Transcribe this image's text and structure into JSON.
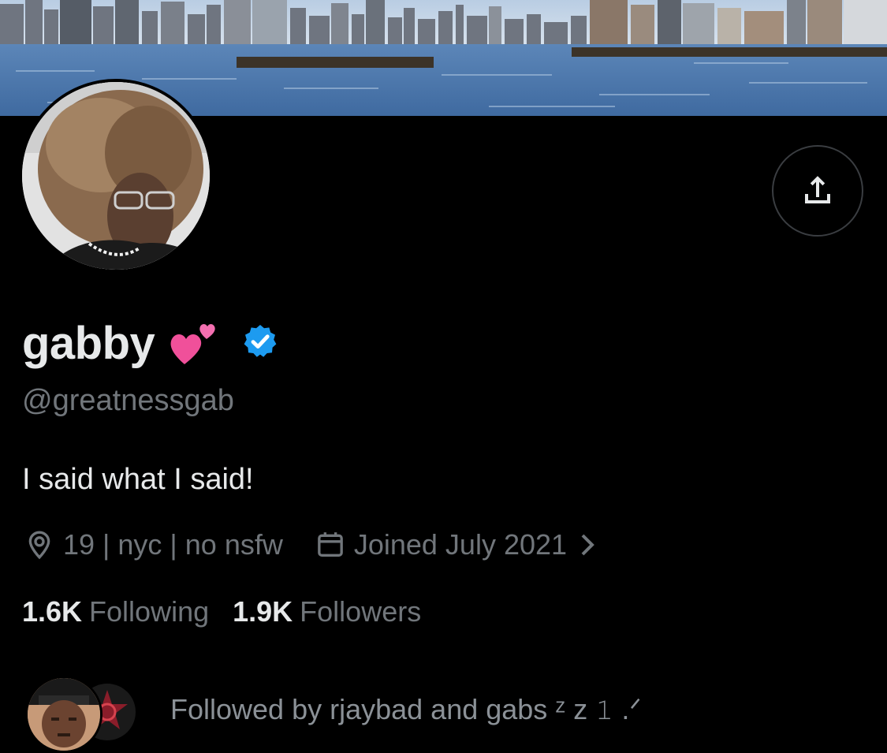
{
  "profile": {
    "display_name": "gabby",
    "name_emoji": "two-hearts-emoji",
    "verified": "verified-badge",
    "handle": "@greatnessgab",
    "bio": "I said what I said!",
    "location": "19 | nyc | no nsfw",
    "joined": "Joined July 2021"
  },
  "stats": {
    "following_count": "1.6K",
    "following_label": "Following",
    "followers_count": "1.9K",
    "followers_label": "Followers"
  },
  "followed_by": {
    "text": "Followed by rjaybad and gabs ᶻ z 𝟷 .ᐟ"
  },
  "icons": {
    "share": "share-icon",
    "location": "location-pin-icon",
    "calendar": "calendar-icon",
    "chevron": "chevron-right-icon"
  },
  "colors": {
    "background": "#000000",
    "primary_text": "#e7e9ea",
    "secondary_text": "#71767b",
    "verified_blue": "#1d9bf0",
    "heart_pink": "#f0509a"
  }
}
